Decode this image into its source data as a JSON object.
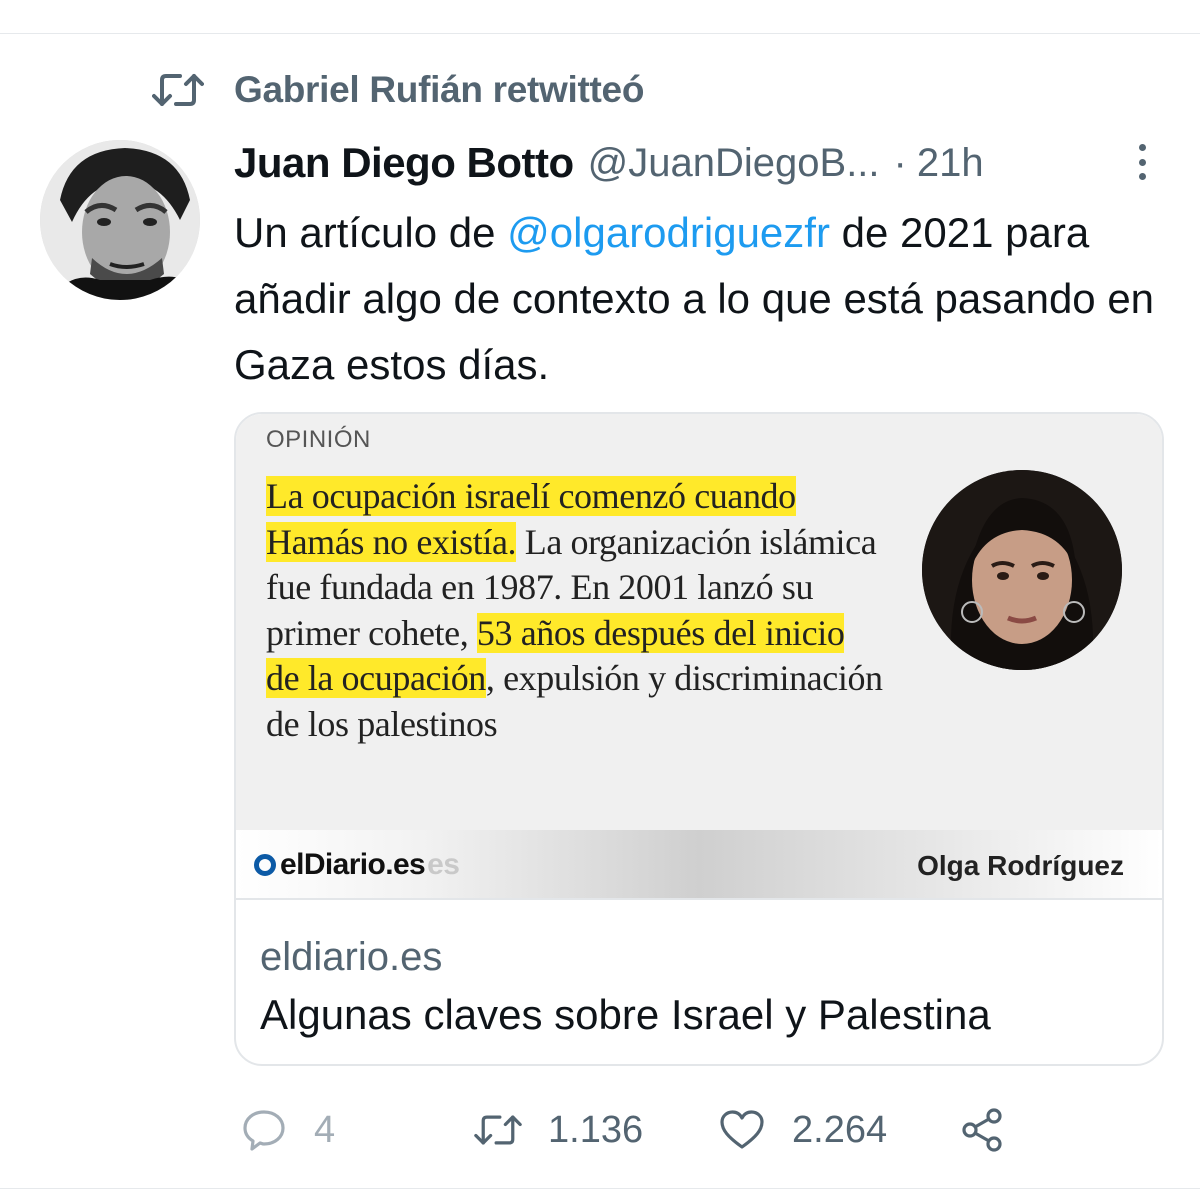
{
  "retweet_banner": {
    "text": "Gabriel Rufián retwitteó",
    "icon": "retweet-icon"
  },
  "tweet": {
    "author_name": "Juan Diego Botto",
    "author_handle": "@JuanDiegoB...",
    "separator": "·",
    "time": "21h",
    "text_parts": {
      "before_mention": "Un artículo de ",
      "mention": "@olgarodriguezfr",
      "after_mention": " de 2021 para añadir algo de contexto a lo que está pasando en Gaza estos días."
    }
  },
  "card": {
    "image": {
      "section_label": "OPINIÓN",
      "quote": {
        "hl1": "La ocupación israelí comenzó cuando Hamás no existía.",
        "t1": " La organización islámica fue fundada en 1987. En 2001 lanzó su primer cohete, ",
        "hl2": "53 años después del inicio de la ocupación",
        "t2": ", expulsión y discriminación de los palestinos"
      },
      "logo_text": "elDiario.es",
      "logo_ghost": "es",
      "byline": "Olga Rodríguez"
    },
    "domain": "eldiario.es",
    "title": "Algunas claves sobre Israel y Palestina"
  },
  "actions": {
    "replies": "4",
    "retweets": "1.136",
    "likes": "2.264"
  },
  "colors": {
    "link": "#1d9bf0",
    "secondary_text": "#536471",
    "highlight": "#ffe92a",
    "logo_blue": "#0c5aa6"
  }
}
